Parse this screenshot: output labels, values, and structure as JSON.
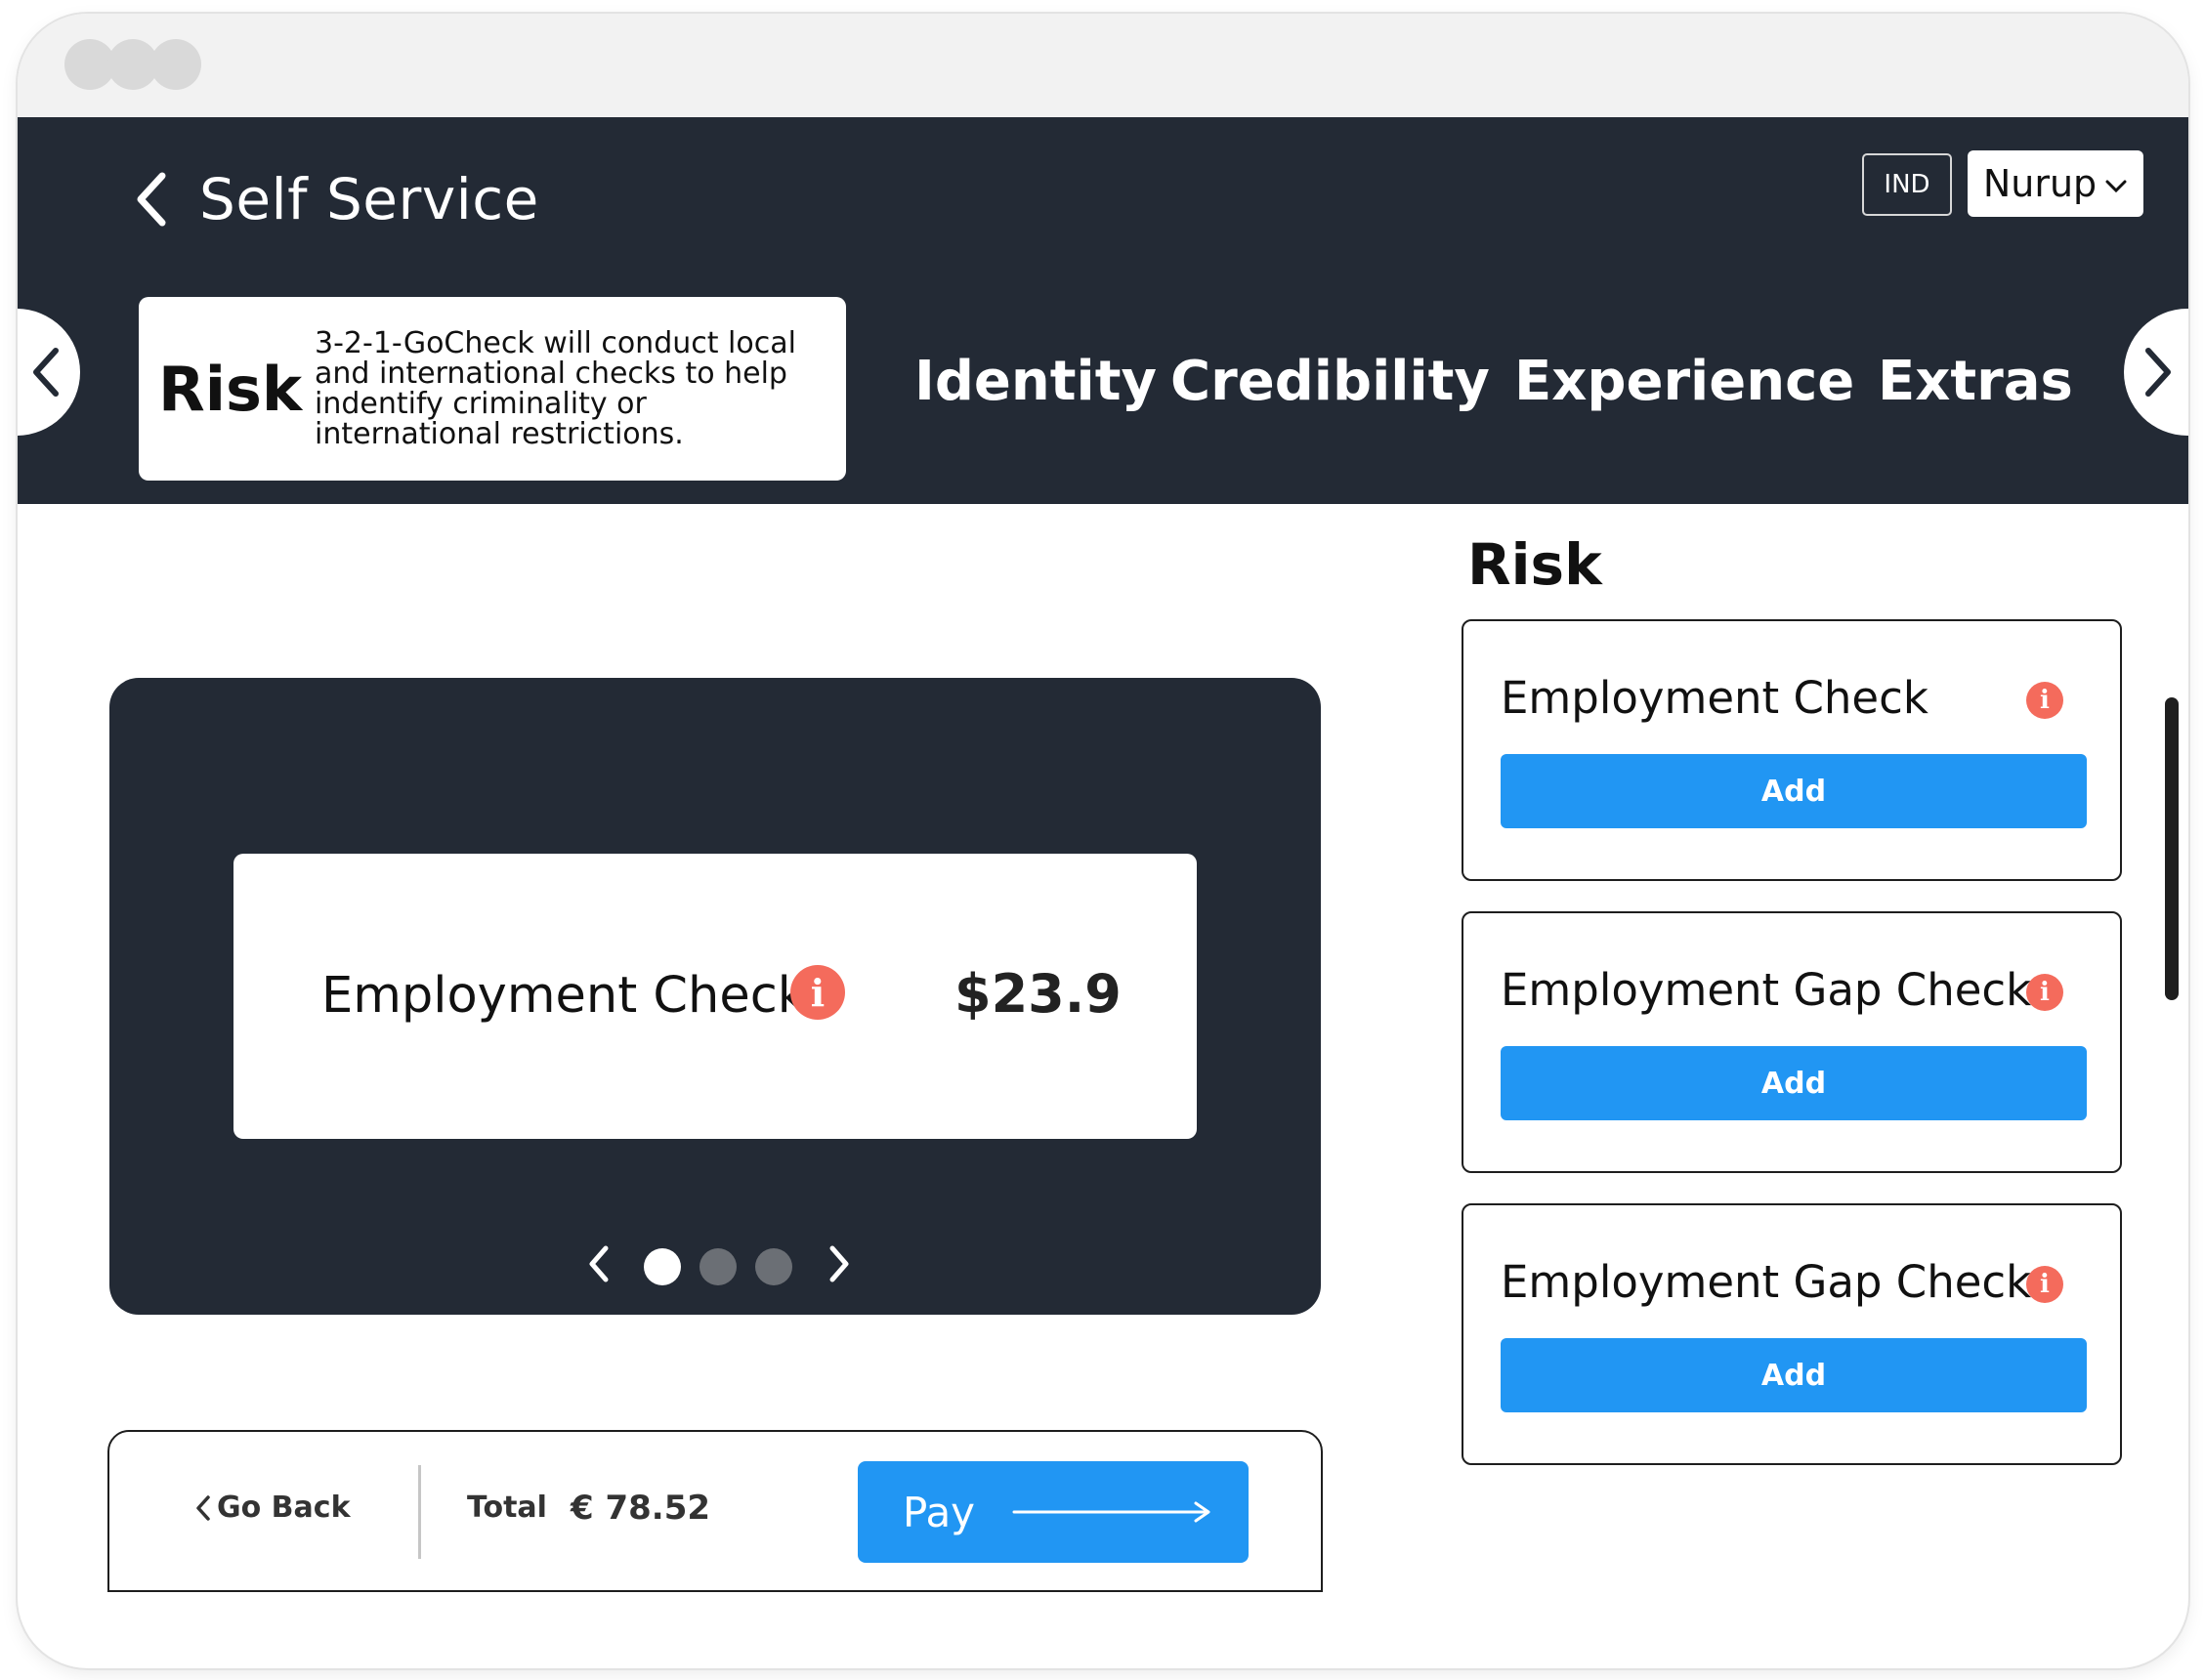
{
  "header": {
    "back_title": "Self Service",
    "language": "IND",
    "user_name": "Nurup"
  },
  "categories": {
    "active": {
      "title": "Risk",
      "description": "3-2-1-GoCheck will conduct local and international checks to help indentify criminality or international restrictions."
    },
    "tabs": [
      {
        "label": "Identity"
      },
      {
        "label": "Credibility"
      },
      {
        "label": "Experience"
      },
      {
        "label": "Extras"
      }
    ]
  },
  "carousel": {
    "item_name": "Employment Check",
    "item_price": "$23.9",
    "total_slides": 3,
    "active_slide": 1
  },
  "footer": {
    "go_back_label": "Go Back",
    "total_label": "Total",
    "total_value": "€ 78.52",
    "pay_label": "Pay"
  },
  "section": {
    "title": "Risk",
    "services": [
      {
        "name": "Employment Check",
        "button": "Add"
      },
      {
        "name": "Employment Gap Check",
        "button": "Add"
      },
      {
        "name": "Employment Gap Check",
        "button": "Add"
      }
    ]
  },
  "colors": {
    "dark": "#232a35",
    "primary": "#2196f3",
    "info": "#f46b5c"
  },
  "icons": {
    "info": "info-icon",
    "back": "chevron-left-icon",
    "dropdown": "chevron-down-icon",
    "pay_arrow": "long-arrow-right-icon"
  }
}
